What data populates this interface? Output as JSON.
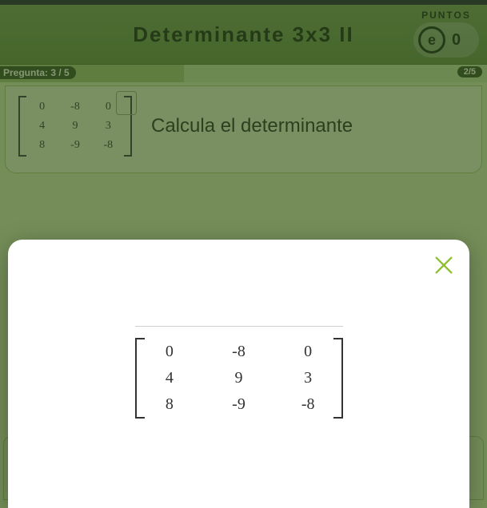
{
  "header": {
    "title": "Determinante 3x3 II",
    "points_label": "PUNTOS",
    "score_letter": "e",
    "score_value": "0"
  },
  "subbar": {
    "question_label": "Pregunta: 3 / 5",
    "progress_label": "2/5"
  },
  "question": {
    "prompt": "Calcula el determinante",
    "matrix": [
      [
        "0",
        "-8",
        "0"
      ],
      [
        "4",
        "9",
        "3"
      ],
      [
        "8",
        "-9",
        "-8"
      ]
    ]
  },
  "modal": {
    "matrix": [
      [
        "0",
        "-8",
        "0"
      ],
      [
        "4",
        "9",
        "3"
      ],
      [
        "8",
        "-9",
        "-8"
      ]
    ]
  }
}
